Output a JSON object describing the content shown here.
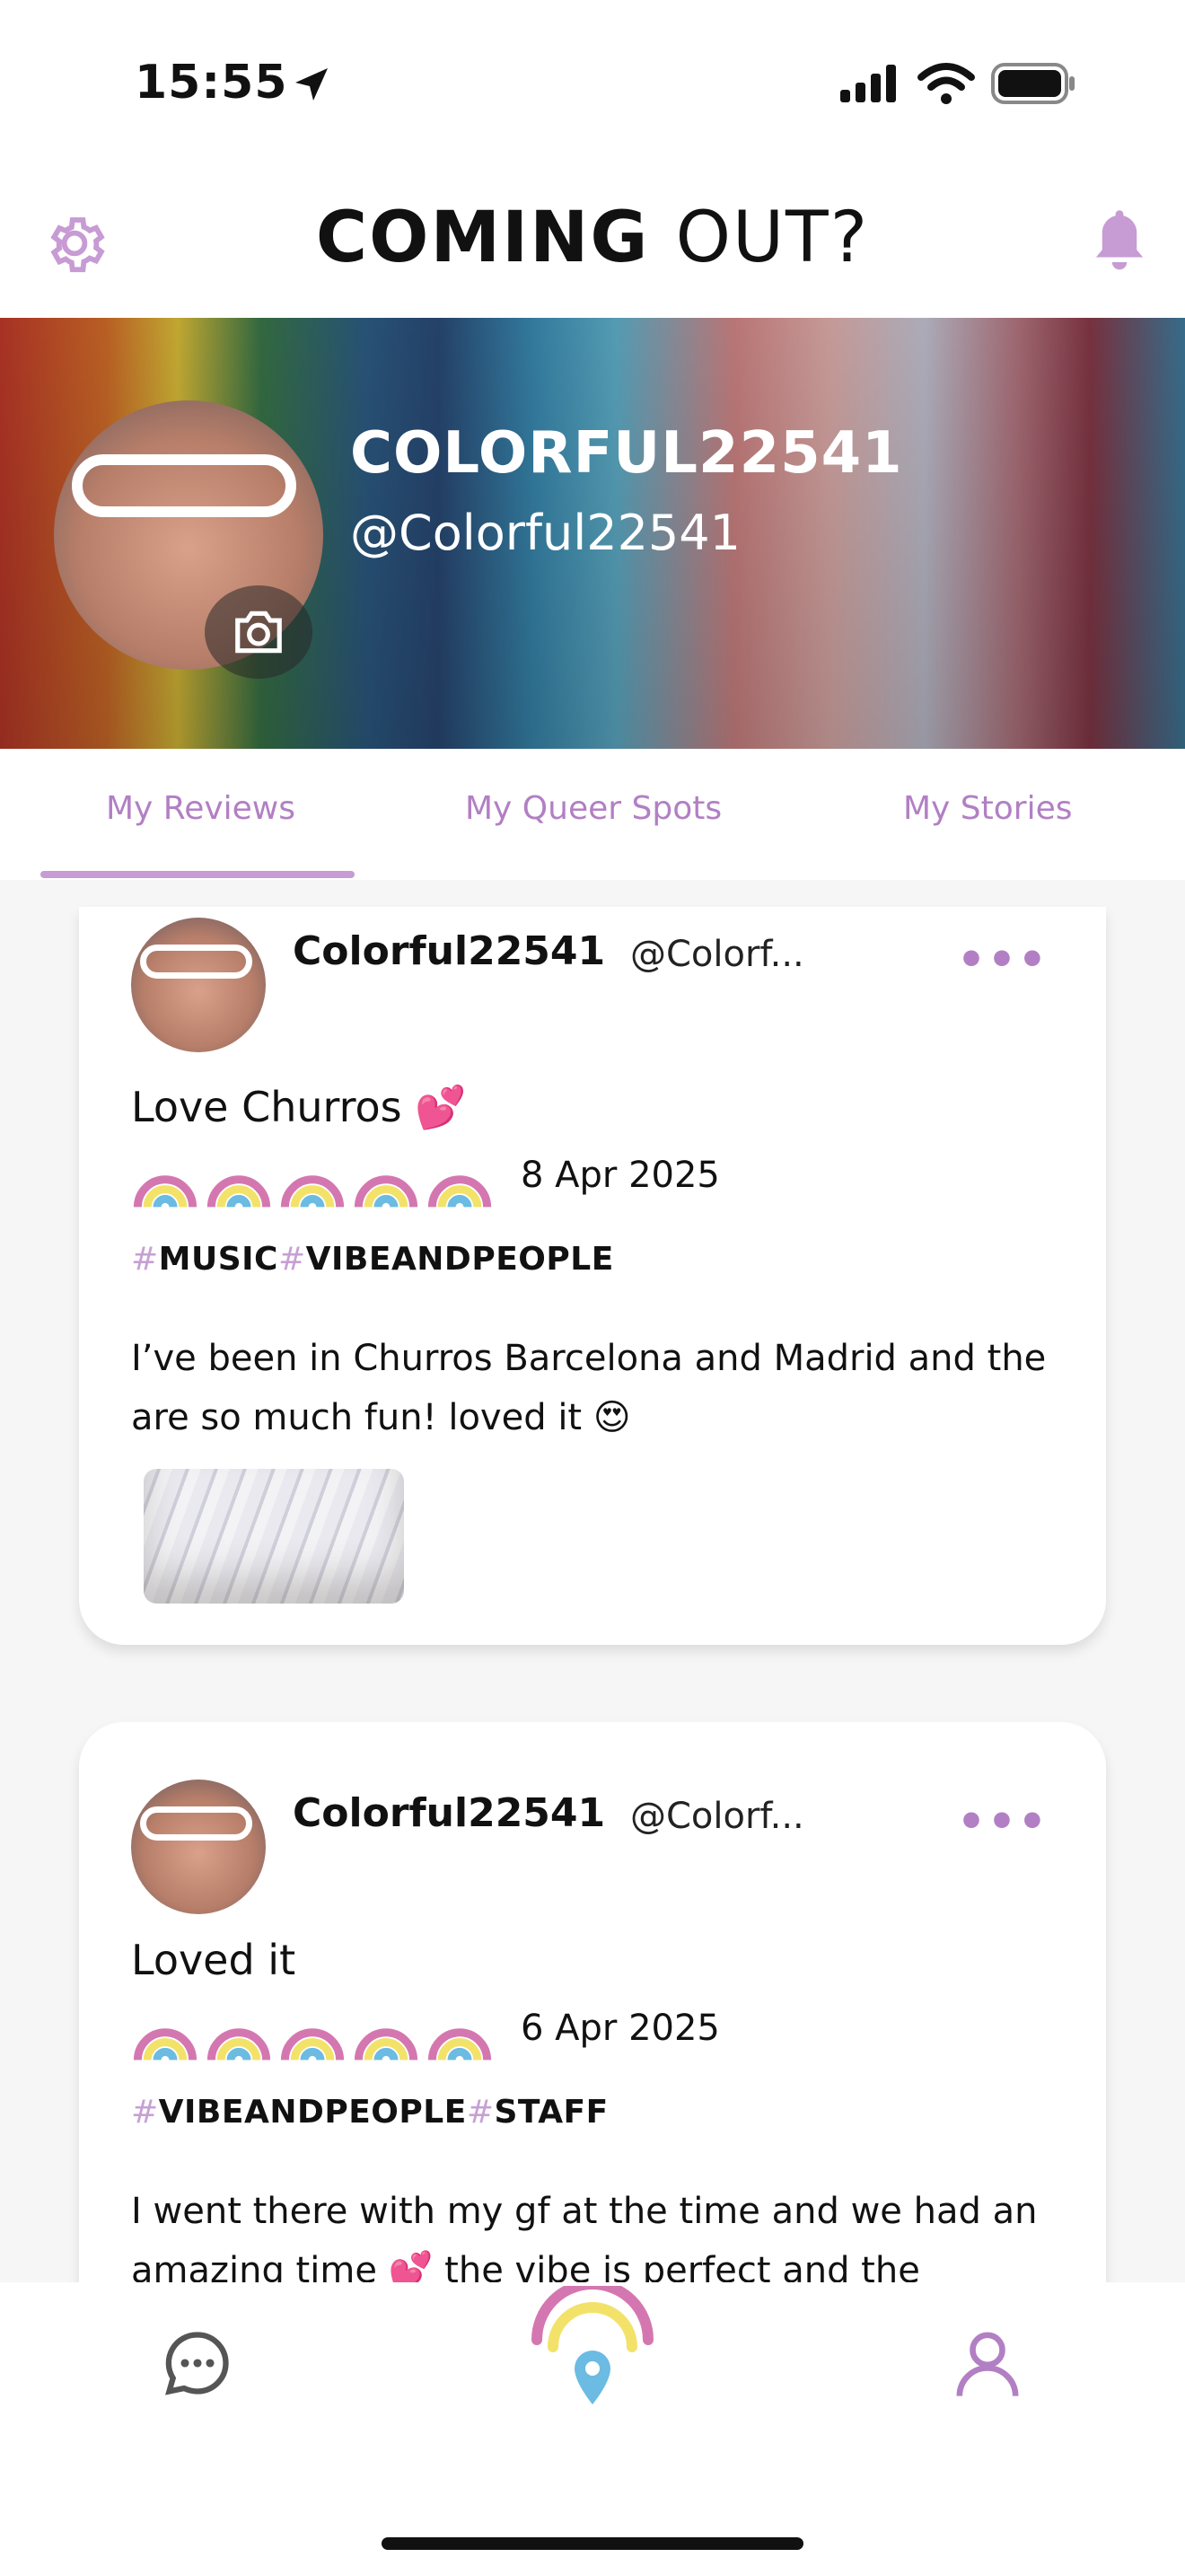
{
  "status_bar": {
    "time": "15:55"
  },
  "header": {
    "logo_main": "COMING",
    "logo_out": "OUT?"
  },
  "profile": {
    "display_name": "COLORFUL22541",
    "handle": "@Colorful22541"
  },
  "tabs": [
    {
      "label": "My Reviews",
      "active": true
    },
    {
      "label": "My Queer Spots",
      "active": false
    },
    {
      "label": "My Stories",
      "active": false
    }
  ],
  "reviews": [
    {
      "user": "Colorful22541",
      "handle": "@Colorf...",
      "title": "Love Churros 💕",
      "rating": 5,
      "date": "8 Apr 2025",
      "tags": [
        "MUSIC",
        "VIBEANDPEOPLE"
      ],
      "body_line1": "I’ve been in Churros Barcelona and Madrid and the",
      "body_line2": "are so much fun! loved it 😍"
    },
    {
      "user": "Colorful22541",
      "handle": "@Colorf...",
      "title": "Loved it",
      "rating": 5,
      "date": "6 Apr 2025",
      "tags": [
        "VIBEANDPEOPLE",
        "STAFF"
      ],
      "body_line1": "I went there with my gf at the time and we had an",
      "body_line2": "amazing time 💕  the vibe is perfect and the"
    }
  ],
  "colors": {
    "accent": "#b27fc4",
    "pin_blue": "#6bbbe3",
    "rainbow_pink": "#d477b0",
    "rainbow_yellow": "#f3e26a"
  },
  "icons": {
    "settings": "gear-icon",
    "notifications": "bell-icon",
    "camera": "camera-icon",
    "chat": "chat-icon",
    "map": "rainbow-pin-icon",
    "profile": "user-icon"
  }
}
